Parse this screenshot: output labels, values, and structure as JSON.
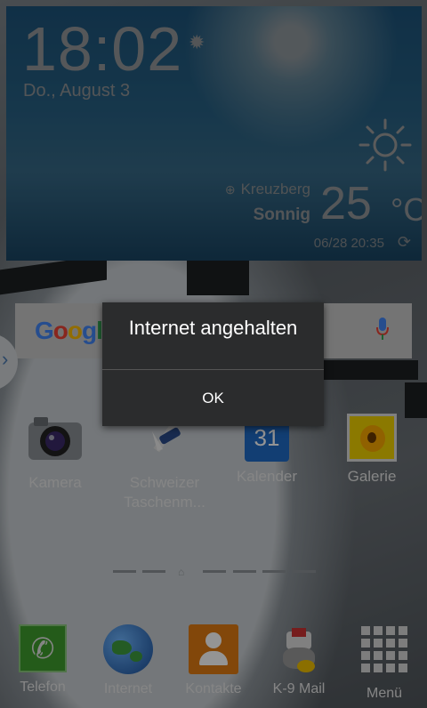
{
  "weather": {
    "time": "18:02",
    "date": "Do., August 3",
    "location": "Kreuzberg",
    "condition": "Sonnig",
    "temperature": "25",
    "unit": "°C",
    "updated": "06/28 20:35",
    "icons": {
      "settings": "gear-icon",
      "weather": "sun-icon",
      "location": "location-icon",
      "refresh": "refresh-icon"
    }
  },
  "search": {
    "logo": "Google",
    "mic_icon": "microphone-icon"
  },
  "apps": [
    {
      "label": "Kamera",
      "icon": "camera-icon"
    },
    {
      "label": "Schweizer Taschenm...",
      "icon": "swiss-knife-icon"
    },
    {
      "label": "Kalender",
      "icon": "calendar-icon",
      "day": "31"
    },
    {
      "label": "Galerie",
      "icon": "gallery-icon"
    }
  ],
  "dock": [
    {
      "label": "Telefon",
      "icon": "phone-icon"
    },
    {
      "label": "Internet",
      "icon": "globe-icon"
    },
    {
      "label": "Kontakte",
      "icon": "contacts-icon"
    },
    {
      "label": "K-9 Mail",
      "icon": "k9-mail-icon"
    },
    {
      "label": "Menü",
      "icon": "apps-grid-icon"
    }
  ],
  "page_indicator": {
    "pages": 7,
    "current": 3
  },
  "dialog": {
    "message": "Internet angehalten",
    "button": "OK"
  }
}
